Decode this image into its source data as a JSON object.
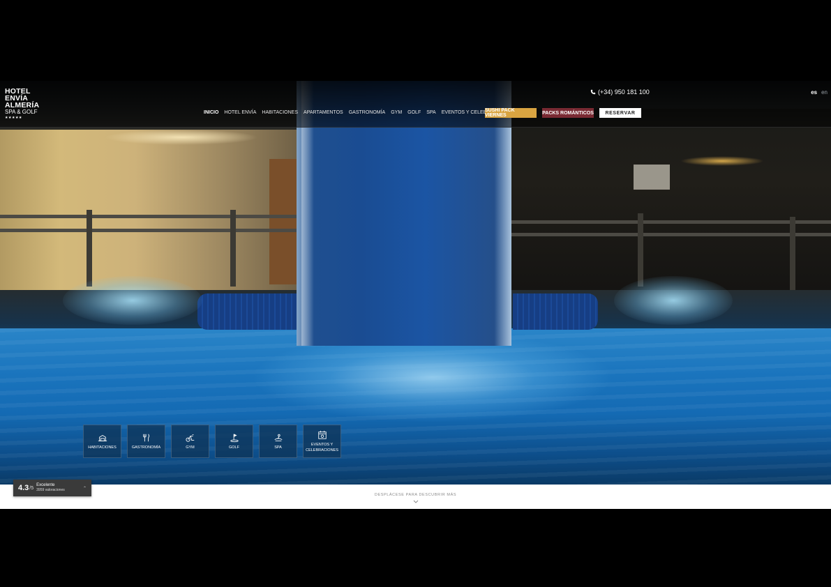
{
  "brand": {
    "line1": "HOTEL",
    "line2": "ENVÍA",
    "line3": "ALMERÍA",
    "line4": "SPA & GOLF",
    "stars": "★★★★★"
  },
  "contact": {
    "phone": "(+34) 950 181 100"
  },
  "languages": [
    {
      "code": "es",
      "active": true
    },
    {
      "code": "en",
      "active": false
    }
  ],
  "nav": {
    "items": [
      "INICIO",
      "HOTEL ENVÍA",
      "HABITACIONES",
      "APARTAMENTOS",
      "GASTRONOMÍA",
      "GYM",
      "GOLF",
      "SPA",
      "EVENTOS Y CELEBRACIONES"
    ],
    "current": "INICIO"
  },
  "buttons": {
    "sushi": "SUSHI PACK VIERNES",
    "packs": "PACKS ROMÁNTICOS",
    "reserve": "RESERVAR"
  },
  "colors": {
    "sushi_bg": "#d9a441",
    "packs_bg": "#7a2a33",
    "reserve_bg": "#ffffff",
    "tile_bg": "#0e3458"
  },
  "tiles": [
    {
      "label": "HABITACIONES",
      "icon": "hotel-bed-icon"
    },
    {
      "label": "GASTRONOMÍA",
      "icon": "fork-knife-icon"
    },
    {
      "label": "GYM",
      "icon": "exercise-bike-icon"
    },
    {
      "label": "GOLF",
      "icon": "golf-flag-icon"
    },
    {
      "label": "SPA",
      "icon": "spa-icon"
    },
    {
      "label": "EVENTOS Y CELEBRACIONES",
      "icon": "calendar-icon"
    }
  ],
  "rating": {
    "score": "4.3",
    "scale": "/5",
    "label": "Excelente",
    "count": "3959 valoraciones"
  },
  "scroll_hint": "DESPLÁCESE PARA DESCUBRIR MÁS"
}
